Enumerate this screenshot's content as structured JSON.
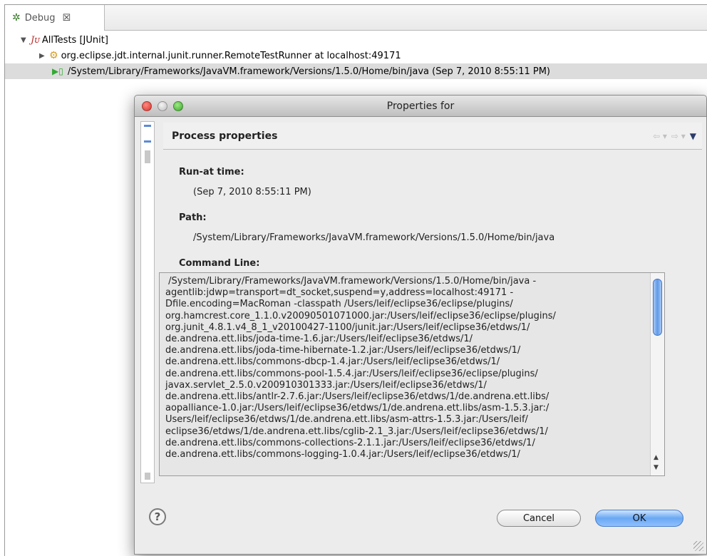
{
  "debug_view": {
    "tab_label": "Debug",
    "tab_close": "☒",
    "tree": [
      {
        "label": "AllTests [JUnit]",
        "prefix": "Jᴜ"
      },
      {
        "label": "org.eclipse.jdt.internal.junit.runner.RemoteTestRunner at localhost:49171"
      },
      {
        "label": "/System/Library/Frameworks/JavaVM.framework/Versions/1.5.0/Home/bin/java (Sep 7, 2010 8:55:11 PM)"
      }
    ]
  },
  "dialog": {
    "title": "Properties for",
    "page_title": "Process properties",
    "sections": {
      "run_at_label": "Run-at time:",
      "run_at_value": "(Sep 7, 2010 8:55:11 PM)",
      "path_label": "Path:",
      "path_value": "/System/Library/Frameworks/JavaVM.framework/Versions/1.5.0/Home/bin/java",
      "cmd_label": "Command Line:"
    },
    "command_line": " /System/Library/Frameworks/JavaVM.framework/Versions/1.5.0/Home/bin/java -\nagentlib:jdwp=transport=dt_socket,suspend=y,address=localhost:49171 -\nDfile.encoding=MacRoman -classpath /Users/leif/eclipse36/eclipse/plugins/\norg.hamcrest.core_1.1.0.v20090501071000.jar:/Users/leif/eclipse36/eclipse/plugins/\norg.junit_4.8.1.v4_8_1_v20100427-1100/junit.jar:/Users/leif/eclipse36/etdws/1/\nde.andrena.ett.libs/joda-time-1.6.jar:/Users/leif/eclipse36/etdws/1/\nde.andrena.ett.libs/joda-time-hibernate-1.2.jar:/Users/leif/eclipse36/etdws/1/\nde.andrena.ett.libs/commons-dbcp-1.4.jar:/Users/leif/eclipse36/etdws/1/\nde.andrena.ett.libs/commons-pool-1.5.4.jar:/Users/leif/eclipse36/eclipse/plugins/\njavax.servlet_2.5.0.v200910301333.jar:/Users/leif/eclipse36/etdws/1/\nde.andrena.ett.libs/antlr-2.7.6.jar:/Users/leif/eclipse36/etdws/1/de.andrena.ett.libs/\naopalliance-1.0.jar:/Users/leif/eclipse36/etdws/1/de.andrena.ett.libs/asm-1.5.3.jar:/\nUsers/leif/eclipse36/etdws/1/de.andrena.ett.libs/asm-attrs-1.5.3.jar:/Users/leif/\neclipse36/etdws/1/de.andrena.ett.libs/cglib-2.1_3.jar:/Users/leif/eclipse36/etdws/1/\nde.andrena.ett.libs/commons-collections-2.1.1.jar:/Users/leif/eclipse36/etdws/1/\nde.andrena.ett.libs/commons-logging-1.0.4.jar:/Users/leif/eclipse36/etdws/1/",
    "buttons": {
      "help": "?",
      "cancel": "Cancel",
      "ok": "OK"
    },
    "nav": {
      "back": "⇦ ▾",
      "forward": "⇨ ▾",
      "menu": "▼"
    },
    "colors": {
      "ok_button": "#6aa8f2",
      "selection_row": "#dcdcdc",
      "scroll_thumb": "#5f9ae8"
    }
  }
}
